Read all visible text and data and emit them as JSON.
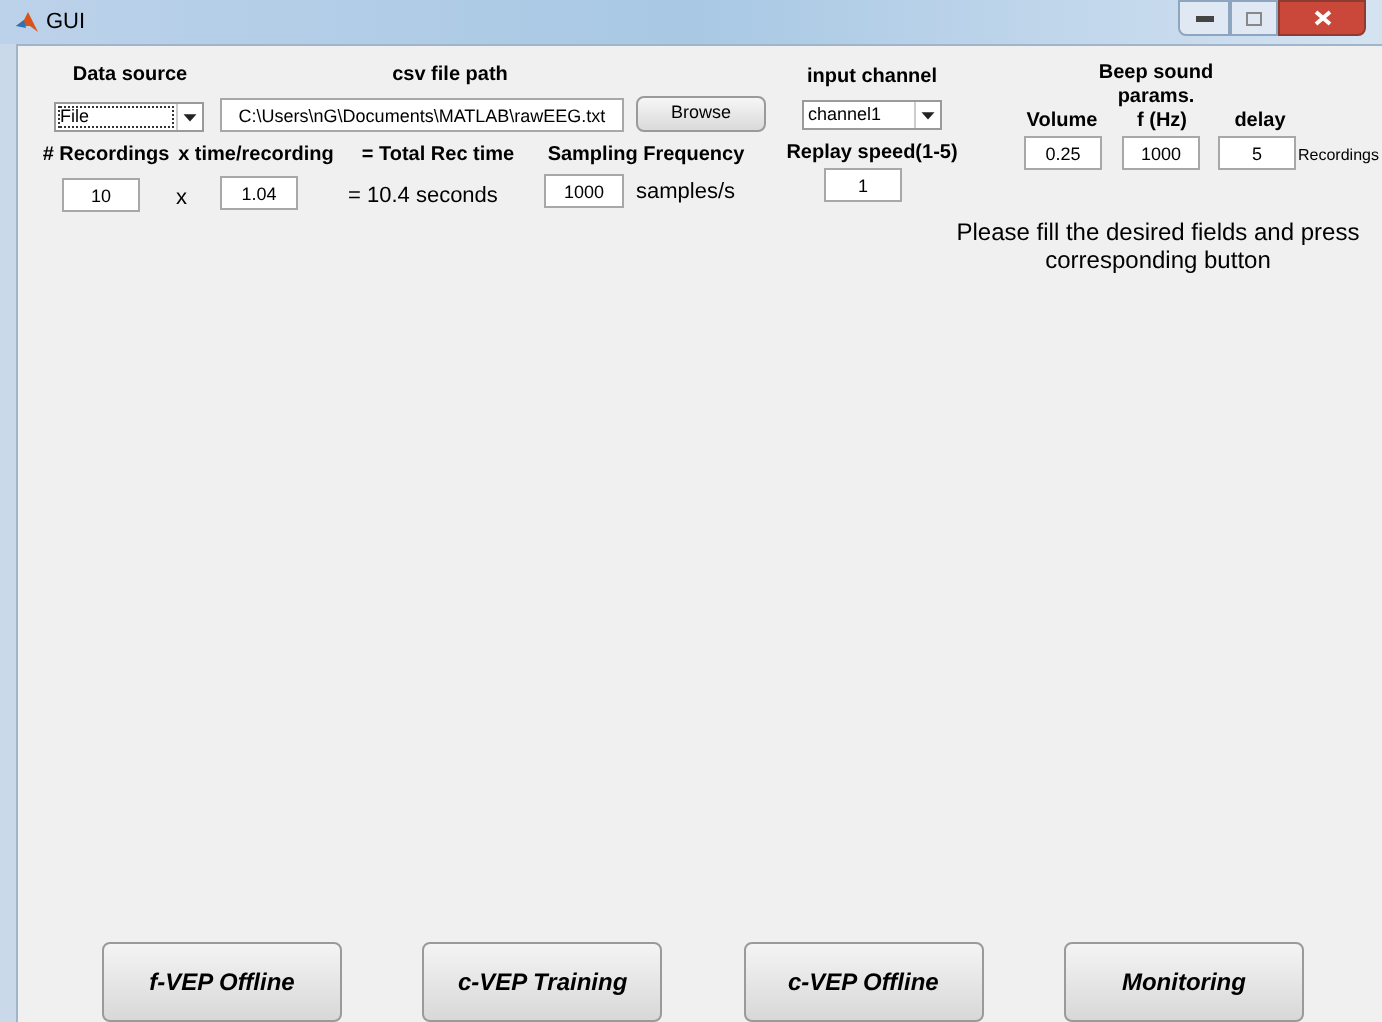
{
  "window": {
    "title": "GUI"
  },
  "labels": [
    "Data source",
    "csv file path",
    "input channel",
    "Beep sound params.",
    "Volume",
    "f (Hz)",
    "delay",
    "# Recordings",
    "x time/recording",
    "= Total Rec time",
    "Sampling Frequency",
    "Replay speed(1-5)"
  ],
  "dropdowns": [
    {
      "value": "File",
      "focused": true
    },
    {
      "value": "channel1",
      "focused": false
    }
  ],
  "fields": [
    "C:\\Users\\nG\\Documents\\MATLAB\\rawEEG.txt",
    "10",
    "1.04",
    "1000",
    "1",
    "0.25",
    "1000",
    "5"
  ],
  "texts": [
    "x",
    "= 10.4 seconds",
    "samples/s"
  ],
  "delay_unit": "Recordings",
  "browse_button": {
    "label": "Browse"
  },
  "message": "Please fill the desired fields and press corresponding button",
  "buttons": [
    {
      "label": "f-VEP Offline"
    },
    {
      "label": "c-VEP Training"
    },
    {
      "label": "c-VEP Offline"
    },
    {
      "label": "Monitoring"
    }
  ]
}
